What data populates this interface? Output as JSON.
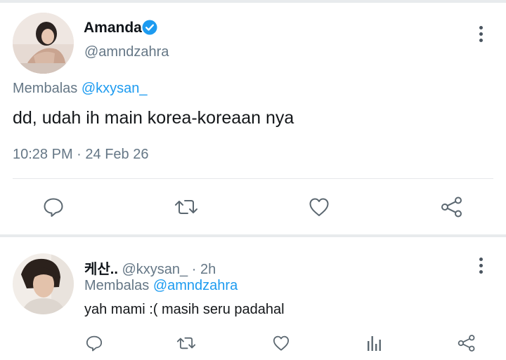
{
  "tweet": {
    "author_name": "Amanda",
    "author_handle": "@amndzahra",
    "verified": true,
    "reply_prefix": "Membalas",
    "reply_to": "@kxysan_",
    "text": "dd, udah ih main korea-koreaan nya",
    "time": "10:28 PM",
    "separator": "·",
    "date": "24 Feb 26",
    "actions": [
      "reply-icon",
      "retweet-icon",
      "like-icon",
      "share-icon"
    ]
  },
  "reply": {
    "author_name": "케산..",
    "author_handle": "@kxysan_",
    "separator": "·",
    "age": "2h",
    "reply_prefix": "Membalas",
    "reply_to": "@amndzahra",
    "text": "yah mami :( masih seru padahal",
    "actions": [
      "reply-icon",
      "retweet-icon",
      "like-icon",
      "analytics-icon",
      "share-icon"
    ]
  },
  "colors": {
    "accent": "#1d9bf0",
    "muted_text": "#657786",
    "icon": "#5b6770",
    "verified_badge": "#1d9bf0"
  }
}
